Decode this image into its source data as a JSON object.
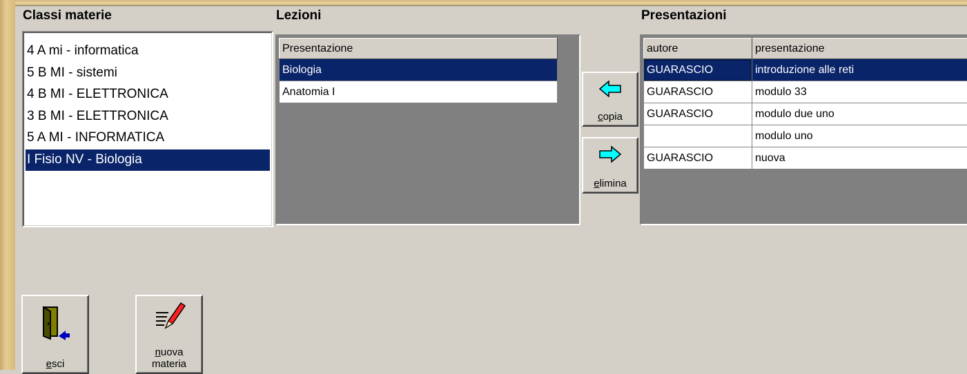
{
  "headings": {
    "classi": "Classi materie",
    "lezioni": "Lezioni",
    "presentazioni": "Presentazioni"
  },
  "classi_list": {
    "items": [
      "4 A mi - informatica",
      "5 B MI - sistemi",
      "4 B MI - ELETTRONICA",
      "3 B MI - ELETTRONICA",
      "5 A MI - INFORMATICA",
      "I Fisio NV - Biologia"
    ],
    "selected_index": 5
  },
  "lezioni_grid": {
    "columns": [
      "Presentazione"
    ],
    "rows": [
      "Biologia",
      "Anatomia I"
    ],
    "selected_index": 0
  },
  "presentazioni_grid": {
    "columns": [
      "autore",
      "presentazione"
    ],
    "rows": [
      {
        "autore": "GUARASCIO",
        "presentazione": "introduzione alle reti"
      },
      {
        "autore": "GUARASCIO",
        "presentazione": "modulo 33"
      },
      {
        "autore": "GUARASCIO",
        "presentazione": "modulo due uno"
      },
      {
        "autore": "",
        "presentazione": "modulo uno"
      },
      {
        "autore": "GUARASCIO",
        "presentazione": "nuova"
      }
    ],
    "selected_index": 0
  },
  "buttons": {
    "copia": {
      "label": "copia",
      "icon": "arrow-left-icon"
    },
    "elimina": {
      "label": "elimina",
      "icon": "arrow-right-icon"
    },
    "esci": {
      "label": "esci",
      "icon": "exit-door-icon"
    },
    "nuova_materia": {
      "label_line1": "nuova",
      "label_line2": "materia",
      "icon": "edit-pencil-icon"
    }
  },
  "colors": {
    "selection": "#0a246a",
    "face": "#d4d0c8",
    "grid_empty": "#808080",
    "arrow": "#00ffff"
  }
}
